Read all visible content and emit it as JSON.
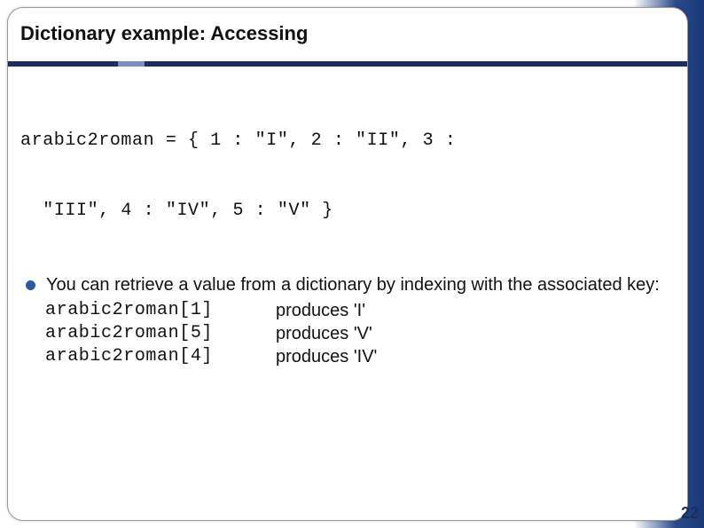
{
  "slide": {
    "title": "Dictionary example: Accessing",
    "code_line1": "arabic2roman = { 1 : \"I\", 2 : \"II\", 3 :",
    "code_line2": "  \"III\", 4 : \"IV\", 5 : \"V\" }",
    "bullet_text": "You can retrieve a value from a dictionary by indexing with the associated key:",
    "examples": [
      {
        "code": "arabic2roman[1]",
        "result": "produces 'I'"
      },
      {
        "code": "arabic2roman[5]",
        "result": "produces 'V'"
      },
      {
        "code": "arabic2roman[4]",
        "result": "produces 'IV'"
      }
    ],
    "page_number": "22"
  }
}
